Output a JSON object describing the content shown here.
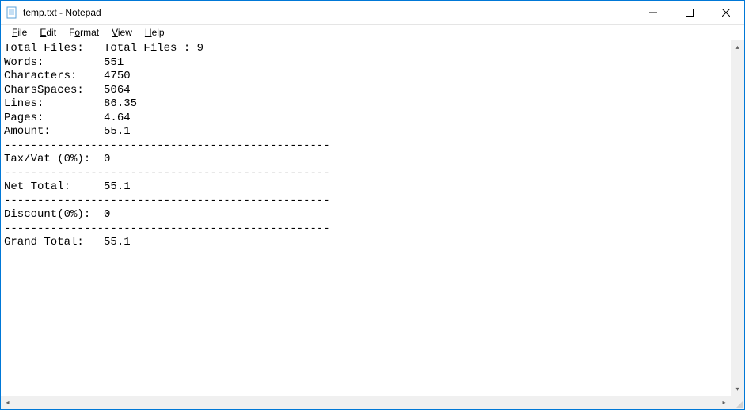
{
  "window": {
    "title": "temp.txt - Notepad"
  },
  "menu": {
    "file": "File",
    "edit": "Edit",
    "format": "Format",
    "view": "View",
    "help": "Help"
  },
  "report": {
    "labels": {
      "total_files": "Total Files:",
      "words": "Words:",
      "characters": "Characters:",
      "chars_spaces": "CharsSpaces:",
      "lines": "Lines:",
      "pages": "Pages:",
      "amount": "Amount:",
      "tax_vat": "Tax/Vat (0%):",
      "net_total": "Net Total:",
      "discount": "Discount(0%):",
      "grand_total": "Grand Total:"
    },
    "values": {
      "total_files": "Total Files : 9",
      "words": "551",
      "characters": "4750",
      "chars_spaces": "5064",
      "lines": "86.35",
      "pages": "4.64",
      "amount": "55.1",
      "tax_vat": "0",
      "net_total": "55.1",
      "discount": "0",
      "grand_total": "55.1"
    },
    "separator": "-------------------------------------------------"
  }
}
